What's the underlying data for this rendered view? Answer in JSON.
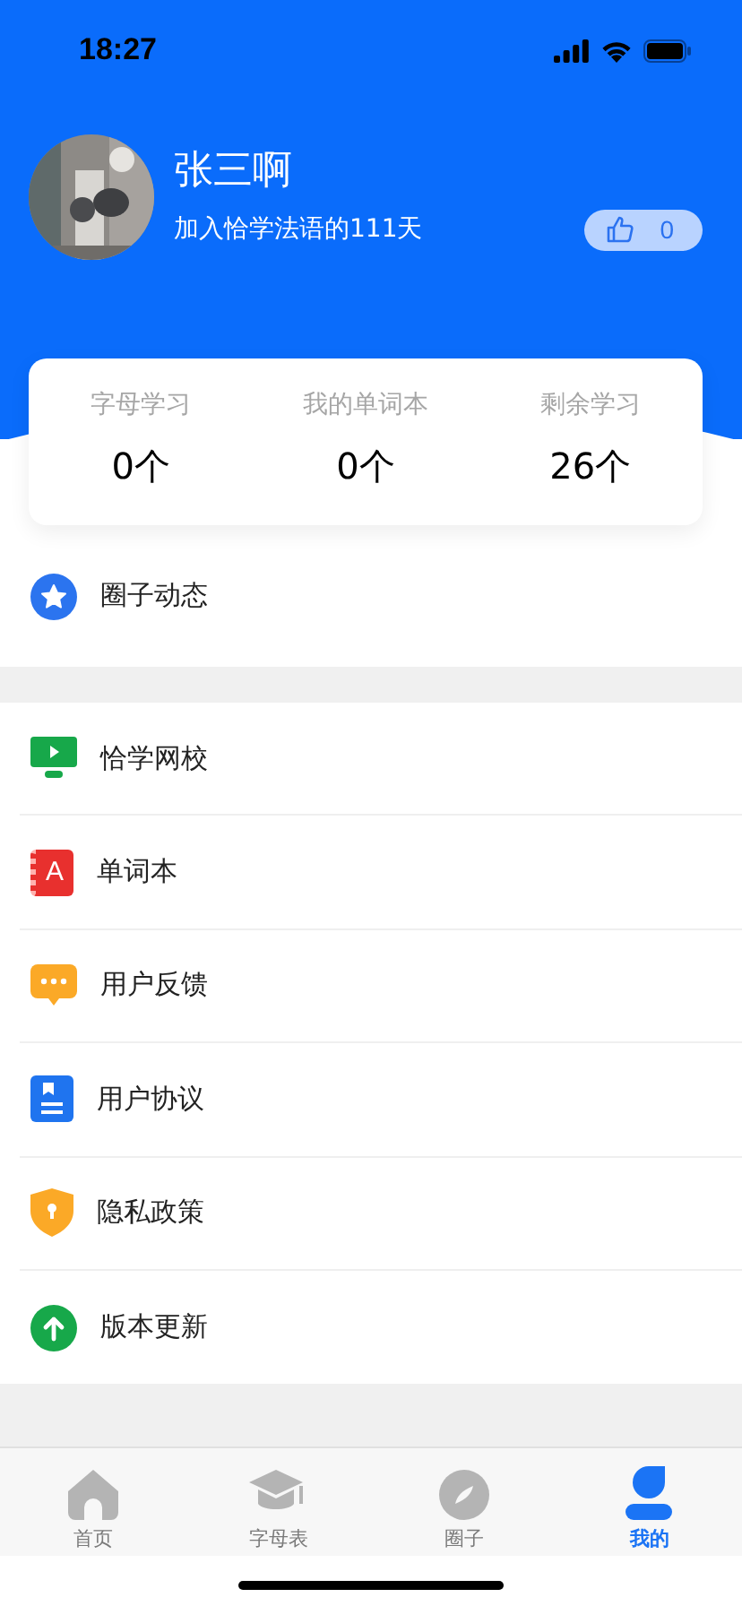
{
  "status_bar": {
    "time": "18:27"
  },
  "profile": {
    "name": "张三啊",
    "joined": "加入恰学法语的111天",
    "likes": "0"
  },
  "stats": [
    {
      "label": "字母学习",
      "value": "0个"
    },
    {
      "label": "我的单词本",
      "value": "0个"
    },
    {
      "label": "剩余学习",
      "value": "26个"
    }
  ],
  "circle_item": {
    "label": "圈子动态"
  },
  "menu": [
    {
      "label": "恰学网校"
    },
    {
      "label": "单词本",
      "icon_letter": "A"
    },
    {
      "label": "用户反馈"
    },
    {
      "label": "用户协议"
    },
    {
      "label": "隐私政策"
    },
    {
      "label": "版本更新"
    }
  ],
  "tabs": [
    {
      "label": "首页",
      "selected": false
    },
    {
      "label": "字母表",
      "selected": false
    },
    {
      "label": "圈子",
      "selected": false
    },
    {
      "label": "我的",
      "selected": true
    }
  ]
}
